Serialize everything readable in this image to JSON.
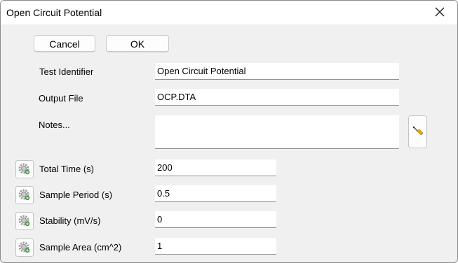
{
  "window": {
    "title": "Open Circuit Potential",
    "close_icon": "close-icon"
  },
  "buttons": {
    "cancel": "Cancel",
    "ok": "OK"
  },
  "fields": {
    "test_identifier": {
      "label": "Test Identifier",
      "value": "Open Circuit Potential"
    },
    "output_file": {
      "label": "Output File",
      "value": "OCP.DTA"
    },
    "notes": {
      "label": "Notes...",
      "value": "",
      "tool_icon": "screwdriver-icon"
    },
    "total_time": {
      "label": "Total Time (s)",
      "value": "200",
      "icon": "gear-icon"
    },
    "sample_period": {
      "label": "Sample Period (s)",
      "value": "0.5",
      "icon": "gear-icon"
    },
    "stability": {
      "label": "Stability (mV/s)",
      "value": "0",
      "icon": "gear-icon"
    },
    "sample_area": {
      "label": "Sample Area (cm^2)",
      "value": "1",
      "icon": "gear-icon"
    }
  }
}
